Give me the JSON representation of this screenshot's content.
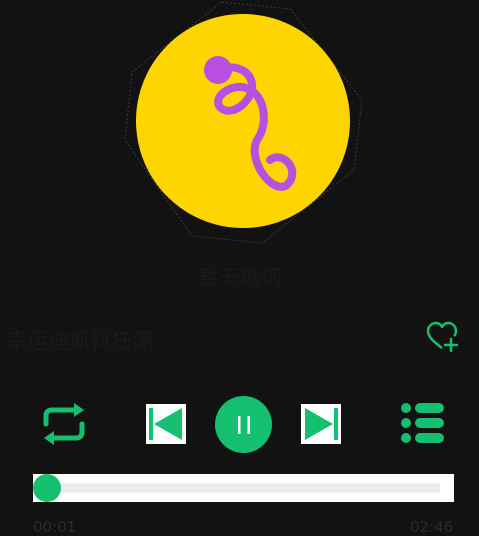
{
  "player": {
    "lyric_placeholder": "暂无歌词",
    "song_title": "幸运迪斯科狂潮",
    "current_time": "00:01",
    "duration": "02:46",
    "progress_fraction": 0.006
  },
  "icons": {
    "album_art": "music-note-icon",
    "favorite": "heart-plus-icon",
    "repeat": "repeat-icon",
    "previous": "skip-previous-icon",
    "play_pause": "pause-icon",
    "next": "skip-next-icon",
    "playlist": "playlist-icon"
  },
  "colors": {
    "background": "#121212",
    "accent": "#15bf70",
    "album_background": "#ffd500",
    "note": "#b84fe0"
  }
}
